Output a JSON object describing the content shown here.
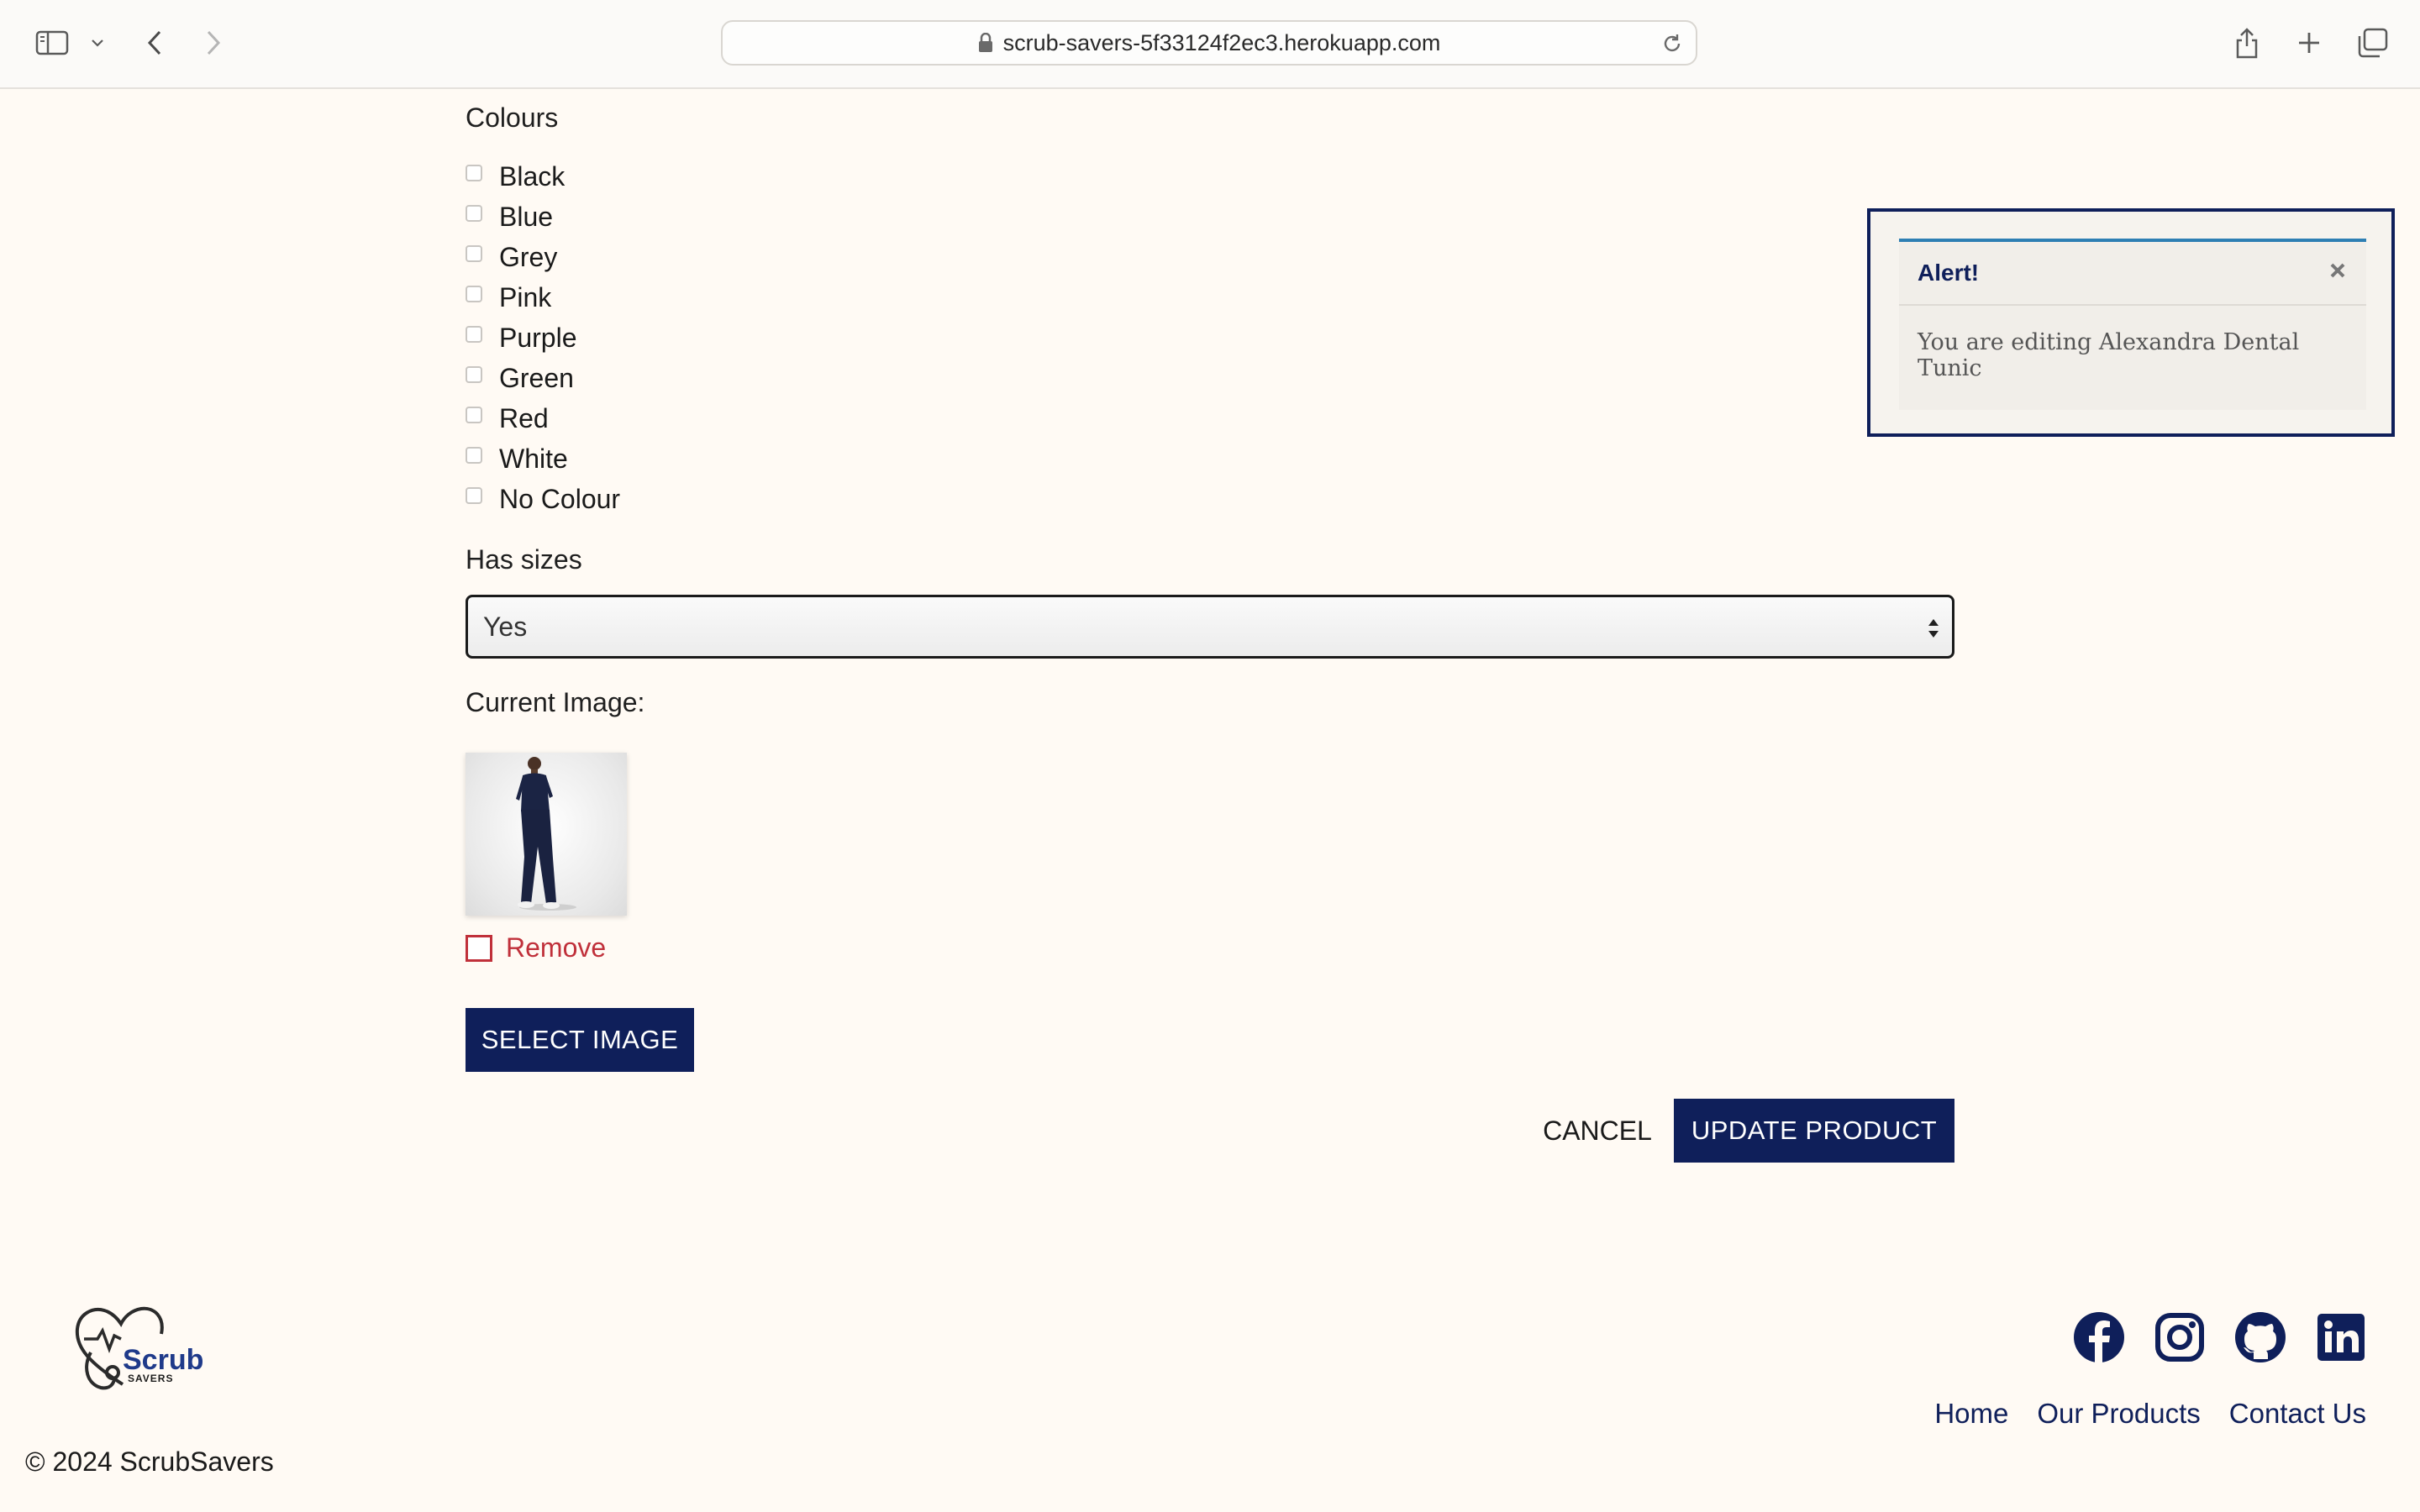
{
  "browser": {
    "url": "scrub-savers-5f33124f2ec3.herokuapp.com"
  },
  "form": {
    "colours_label": "Colours",
    "colours": [
      {
        "label": "Black",
        "checked": false
      },
      {
        "label": "Blue",
        "checked": false
      },
      {
        "label": "Grey",
        "checked": false
      },
      {
        "label": "Pink",
        "checked": false
      },
      {
        "label": "Purple",
        "checked": false
      },
      {
        "label": "Green",
        "checked": false
      },
      {
        "label": "Red",
        "checked": false
      },
      {
        "label": "White",
        "checked": false
      },
      {
        "label": "No Colour",
        "checked": false
      }
    ],
    "has_sizes_label": "Has sizes",
    "has_sizes_value": "Yes",
    "current_image_label": "Current Image:",
    "remove_label": "Remove",
    "select_image_button": "SELECT IMAGE",
    "cancel_button": "CANCEL",
    "update_button": "UPDATE PRODUCT"
  },
  "alert": {
    "title": "Alert!",
    "message": "You are editing Alexandra Dental Tunic"
  },
  "footer": {
    "logo_text": "Scrub",
    "logo_subtext": "SAVERS",
    "copyright": "© 2024 ScrubSavers",
    "social_icons": [
      "facebook-icon",
      "instagram-icon",
      "github-icon",
      "linkedin-icon"
    ],
    "links": [
      "Home",
      "Our Products",
      "Contact Us"
    ]
  },
  "colors": {
    "background": "#fffaf4",
    "primary": "#0f1f5a",
    "danger": "#c0303a",
    "alert_accent": "#2e7fb3"
  }
}
